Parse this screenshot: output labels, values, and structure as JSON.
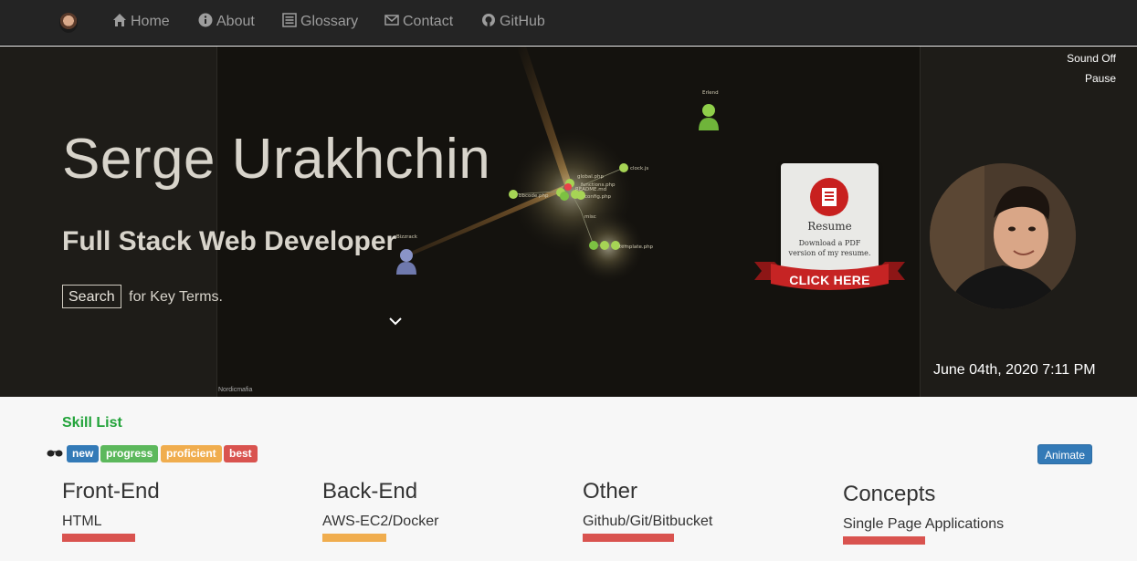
{
  "nav": {
    "items": [
      {
        "label": "Home",
        "icon": "home-icon"
      },
      {
        "label": "About",
        "icon": "info-icon"
      },
      {
        "label": "Glossary",
        "icon": "list-icon"
      },
      {
        "label": "Contact",
        "icon": "envelope-icon"
      },
      {
        "label": "GitHub",
        "icon": "github-icon"
      }
    ]
  },
  "hero": {
    "name": "Serge Urakhchin",
    "role": "Full Stack Web Developer",
    "search_label": "Search",
    "search_suffix": "for Key Terms.",
    "sound_toggle": "Sound Off",
    "pause": "Pause",
    "datetime": "June 04th, 2020 7:11 PM",
    "credit": "Nordicmafia",
    "visualization_nodes": [
      "Erlend",
      "Bizzrack",
      "clock.js",
      "global.php",
      "functions.php",
      "config.php",
      "README.md",
      "misc",
      "bbcode.php",
      "template.php"
    ]
  },
  "resume": {
    "title": "Resume",
    "description_line1": "Download a PDF",
    "description_line2": "version of my resume.",
    "cta": "CLICK HERE"
  },
  "skills": {
    "title": "Skill List",
    "legend": [
      "new",
      "progress",
      "proficient",
      "best"
    ],
    "animate_label": "Animate",
    "columns": [
      {
        "heading": "Front-End",
        "item": "HTML",
        "level": "best"
      },
      {
        "heading": "Back-End",
        "item": "AWS-EC2/Docker",
        "level": "proficient"
      },
      {
        "heading": "Other",
        "item": "Github/Git/Bitbucket",
        "level": "best"
      },
      {
        "heading": "Concepts",
        "item": "Single Page Applications",
        "level": "best"
      }
    ]
  },
  "colors": {
    "navbar": "#242424",
    "hero_bg": "#1e1c18",
    "badge_new": "#337ab7",
    "badge_progress": "#5cb85c",
    "badge_proficient": "#f0ad4e",
    "badge_best": "#d9534f",
    "skill_title": "#22a33a"
  }
}
